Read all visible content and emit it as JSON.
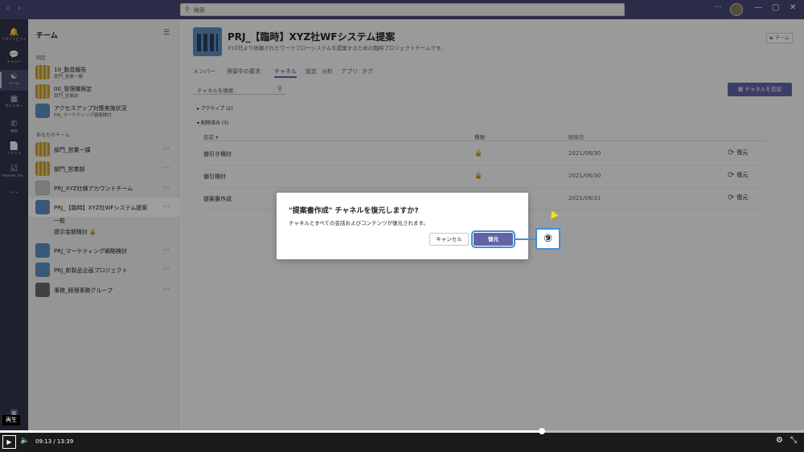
{
  "titlebar": {
    "search_placeholder": "検索",
    "back_icon": "chevron-left-icon",
    "forward_icon": "chevron-right-icon"
  },
  "rail": {
    "items": [
      {
        "label": "アクティビティ",
        "icon": "bell-icon"
      },
      {
        "label": "チャット",
        "icon": "chat-icon"
      },
      {
        "label": "チーム",
        "icon": "teams-icon"
      },
      {
        "label": "カレンダー",
        "icon": "calendar-icon"
      },
      {
        "label": "通話",
        "icon": "phone-icon"
      },
      {
        "label": "ファイル",
        "icon": "file-icon"
      },
      {
        "label": "Planner (Ta...",
        "icon": "planner-icon"
      }
    ]
  },
  "teams_panel": {
    "header": "チーム",
    "section_pinned": "固定",
    "section_your_teams": "あなたのチーム",
    "pinned": [
      {
        "name": "10_勤怠報告",
        "sub": "部門_営業一課"
      },
      {
        "name": "00_管理職限定",
        "sub": "部門_営業部"
      },
      {
        "name": "アクセスアップ対策実施状況",
        "sub": "PRJ_マーケティング戦略検討"
      }
    ],
    "teams": [
      {
        "name": "部門_営業一課"
      },
      {
        "name": "部門_営業部"
      },
      {
        "name": "PRJ_XYZ社様アカウントチーム"
      },
      {
        "name": "PRJ_【臨時】XYZ社WFシステム提案"
      },
      {
        "name": "PRJ_マーケティング戦略検討"
      },
      {
        "name": "PRJ_新製品企画プロジェクト"
      },
      {
        "name": "事務_経理事務グループ"
      }
    ],
    "sub_channels": [
      "一般",
      "提示金額検討"
    ]
  },
  "main": {
    "title": "PRJ_【臨時】XYZ社WFシステム提案",
    "title_more": "···",
    "description": "XYZ社より依頼されたワークフローシステムを提案するための臨時プロジェクトチームです。",
    "team_button": "チーム",
    "tabs": [
      {
        "label": "メンバー"
      },
      {
        "label": "保留中の要求"
      },
      {
        "label": "チャネル"
      },
      {
        "label": "設定"
      },
      {
        "label": "分析"
      },
      {
        "label": "アプリ"
      },
      {
        "label": "タグ"
      }
    ],
    "channel_search_placeholder": "チャネルを検索",
    "add_channel": "チャネルを追加",
    "group_active": "アクティブ (2)",
    "group_deleted": "削除済み (3)",
    "columns": {
      "name": "名前 ▾",
      "privacy": "種類",
      "deleted": "削除日"
    },
    "rows": [
      {
        "name": "値引き検討",
        "date": "2021/08/30",
        "action": "復元"
      },
      {
        "name": "値引検討",
        "date": "2021/08/30",
        "action": "復元"
      },
      {
        "name": "提案書作成",
        "date": "2021/08/31",
        "action": "復元"
      }
    ]
  },
  "dialog": {
    "title": "\"提案書作成\" チャネルを復元しますか?",
    "body": "チャネルとすべての会話およびコンテンツが復元されます。",
    "cancel": "キャンセル",
    "restore": "復元"
  },
  "callout": {
    "label": "⑨"
  },
  "player": {
    "tooltip": "再生",
    "time": "09:13  /  13:39",
    "progress": 0.674
  },
  "colors": {
    "accent": "#6264a7",
    "titlebar": "#464775",
    "rail": "#33344a",
    "callout_border": "#3f8fd8"
  }
}
